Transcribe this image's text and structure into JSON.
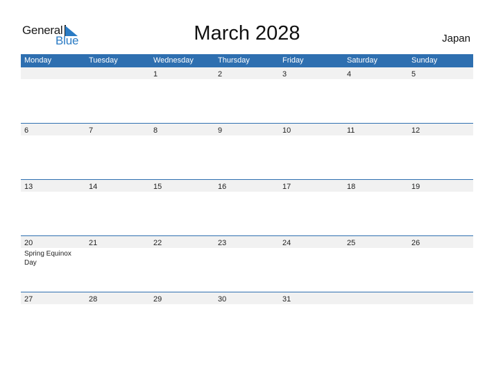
{
  "logo": {
    "word1": "General",
    "word2": "Blue",
    "color": "#2a7bc4"
  },
  "title": "March 2028",
  "country": "Japan",
  "header_color": "#2e6fb0",
  "weekdays": [
    "Monday",
    "Tuesday",
    "Wednesday",
    "Thursday",
    "Friday",
    "Saturday",
    "Sunday"
  ],
  "weeks": [
    {
      "days": [
        {
          "date": "",
          "event": ""
        },
        {
          "date": "",
          "event": ""
        },
        {
          "date": "1",
          "event": ""
        },
        {
          "date": "2",
          "event": ""
        },
        {
          "date": "3",
          "event": ""
        },
        {
          "date": "4",
          "event": ""
        },
        {
          "date": "5",
          "event": ""
        }
      ]
    },
    {
      "days": [
        {
          "date": "6",
          "event": ""
        },
        {
          "date": "7",
          "event": ""
        },
        {
          "date": "8",
          "event": ""
        },
        {
          "date": "9",
          "event": ""
        },
        {
          "date": "10",
          "event": ""
        },
        {
          "date": "11",
          "event": ""
        },
        {
          "date": "12",
          "event": ""
        }
      ]
    },
    {
      "days": [
        {
          "date": "13",
          "event": ""
        },
        {
          "date": "14",
          "event": ""
        },
        {
          "date": "15",
          "event": ""
        },
        {
          "date": "16",
          "event": ""
        },
        {
          "date": "17",
          "event": ""
        },
        {
          "date": "18",
          "event": ""
        },
        {
          "date": "19",
          "event": ""
        }
      ]
    },
    {
      "days": [
        {
          "date": "20",
          "event": "Spring Equinox Day"
        },
        {
          "date": "21",
          "event": ""
        },
        {
          "date": "22",
          "event": ""
        },
        {
          "date": "23",
          "event": ""
        },
        {
          "date": "24",
          "event": ""
        },
        {
          "date": "25",
          "event": ""
        },
        {
          "date": "26",
          "event": ""
        }
      ]
    },
    {
      "days": [
        {
          "date": "27",
          "event": ""
        },
        {
          "date": "28",
          "event": ""
        },
        {
          "date": "29",
          "event": ""
        },
        {
          "date": "30",
          "event": ""
        },
        {
          "date": "31",
          "event": ""
        },
        {
          "date": "",
          "event": ""
        },
        {
          "date": "",
          "event": ""
        }
      ]
    }
  ]
}
